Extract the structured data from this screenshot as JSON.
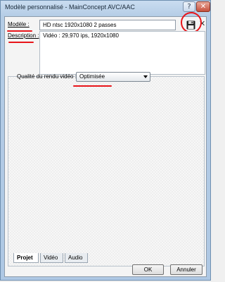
{
  "window": {
    "title": "Modèle personnalisé - MainConcept AVC/AAC",
    "help_label": "?",
    "close_label": "✕"
  },
  "form": {
    "model_label": "Modèle :",
    "model_value": "HD ntsc 1920x1080 2 passes",
    "description_label": "Description :",
    "description_value": "Vidéo : 29,970 ips, 1920x1080",
    "quality_label": "Qualité du rendu vidéo :",
    "quality_value": "Optimisée",
    "delete_label": "✕"
  },
  "tabs": [
    {
      "label": "Projet",
      "active": true
    },
    {
      "label": "Vidéo",
      "active": false
    },
    {
      "label": "Audio",
      "active": false
    }
  ],
  "buttons": {
    "ok_label": "OK",
    "cancel_label": "Annuler"
  },
  "colors": {
    "annotation": "#e8151a",
    "title_bar": "#b5cde6"
  },
  "icons": {
    "save": "floppy-disk-icon"
  }
}
